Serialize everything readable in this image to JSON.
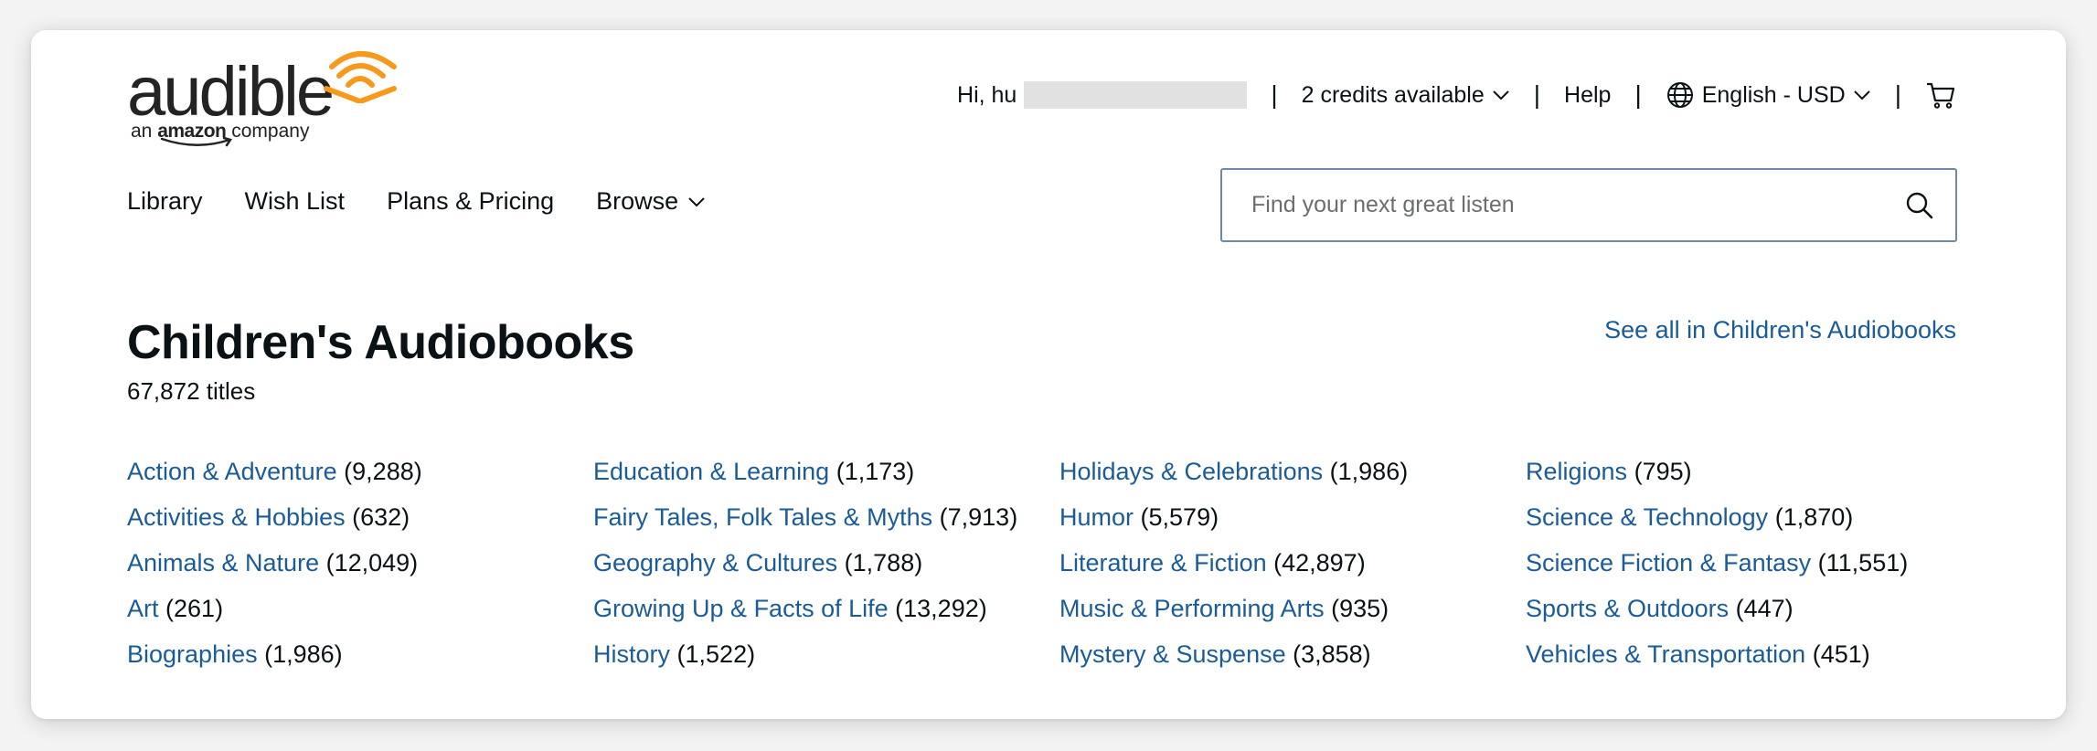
{
  "brand": {
    "wordmark": "audible",
    "tagline_pre": "an",
    "tagline_brand": "amazon",
    "tagline_post": "company",
    "accent_color": "#f7991c"
  },
  "topbar": {
    "greeting": "Hi, hu",
    "credits": "2 credits available",
    "help": "Help",
    "language": "English - USD",
    "separator": "|"
  },
  "nav": {
    "library": "Library",
    "wishlist": "Wish List",
    "plans": "Plans & Pricing",
    "browse": "Browse"
  },
  "search": {
    "placeholder": "Find your next great listen"
  },
  "page": {
    "title": "Children's Audiobooks",
    "count": "67,872 titles",
    "see_all": "See all in Children's Audiobooks"
  },
  "categories": [
    [
      {
        "label": "Action & Adventure",
        "count": "(9,288)"
      },
      {
        "label": "Activities & Hobbies",
        "count": "(632)"
      },
      {
        "label": "Animals & Nature",
        "count": "(12,049)"
      },
      {
        "label": "Art",
        "count": "(261)"
      },
      {
        "label": "Biographies",
        "count": "(1,986)"
      }
    ],
    [
      {
        "label": "Education & Learning",
        "count": "(1,173)"
      },
      {
        "label": "Fairy Tales, Folk Tales & Myths",
        "count": "(7,913)"
      },
      {
        "label": "Geography & Cultures",
        "count": "(1,788)"
      },
      {
        "label": "Growing Up & Facts of Life",
        "count": "(13,292)"
      },
      {
        "label": "History",
        "count": "(1,522)"
      }
    ],
    [
      {
        "label": "Holidays & Celebrations",
        "count": "(1,986)"
      },
      {
        "label": "Humor",
        "count": "(5,579)"
      },
      {
        "label": "Literature & Fiction",
        "count": "(42,897)"
      },
      {
        "label": "Music & Performing Arts",
        "count": "(935)"
      },
      {
        "label": "Mystery & Suspense",
        "count": "(3,858)"
      }
    ],
    [
      {
        "label": "Religions",
        "count": "(795)"
      },
      {
        "label": "Science & Technology",
        "count": "(1,870)"
      },
      {
        "label": "Science Fiction & Fantasy",
        "count": "(11,551)"
      },
      {
        "label": "Sports & Outdoors",
        "count": "(447)"
      },
      {
        "label": "Vehicles & Transportation",
        "count": "(451)"
      }
    ]
  ],
  "icons": {
    "logo_waves": "audible-waves-icon",
    "chevron": "chevron-down-icon",
    "globe": "globe-icon",
    "cart": "cart-icon",
    "search": "search-icon"
  }
}
